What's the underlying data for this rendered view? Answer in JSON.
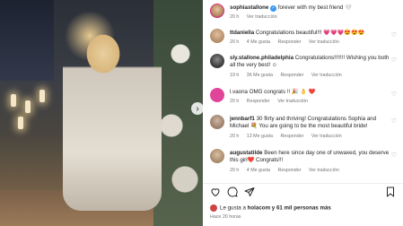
{
  "post": {
    "caption": {
      "username": "sophiastallone",
      "verified": "✓",
      "text": "forever with my best friend 🤍",
      "time": "20 h",
      "translate": "Ver traducción"
    },
    "comments": [
      {
        "username": "ttdaniella",
        "text": "Congratulations beautiful!!! 💗💗💗😍😍😍",
        "time": "20 h",
        "likes": "4 Me gusta",
        "reply": "Responder",
        "translate": "Ver traducción",
        "avatar_color": "#b58e6a"
      },
      {
        "username": "sly.stallone.philadelphia",
        "text": "Congratulations!!!!!!! Wishing you both all the very best! ☺",
        "time": "19 h",
        "likes": "36 Me gusta",
        "reply": "Responder",
        "translate": "Ver traducción",
        "avatar_color": "#3a3a3a"
      },
      {
        "username": "l.vaona",
        "text": "OMG congrats !! 🎉 👌 ❤️",
        "time": "20 h",
        "likes": "",
        "reply": "Responder",
        "translate": "Ver traducción",
        "avatar_color": "#e0459a"
      },
      {
        "username": "jennbarf1",
        "text": "30 flirty and thriving! Congratulations Sophia and Michael 💐 You are going to be the most beautiful bride!",
        "time": "20 h",
        "likes": "13 Me gusta",
        "reply": "Responder",
        "translate": "Ver traducción",
        "avatar_color": "#9c7f6a"
      },
      {
        "username": "augustatilde",
        "text": "Been here since day one of unwaxed, you deserve this girl❤️ Congrats!!!",
        "time": "20 h",
        "likes": "4 Me gusta",
        "reply": "Responder",
        "translate": "Ver traducción",
        "avatar_color": "#a88a6b"
      }
    ],
    "likes_text": {
      "prefix": "Le gusta a ",
      "user": "holacom",
      "suffix": " y 61 mil personas más"
    },
    "posted_ago": "Hace 20 horas"
  },
  "icons": {
    "like": "heart-outline-icon",
    "comment": "comment-icon",
    "share": "send-icon",
    "save": "bookmark-icon",
    "next": "chevron-right-icon"
  }
}
